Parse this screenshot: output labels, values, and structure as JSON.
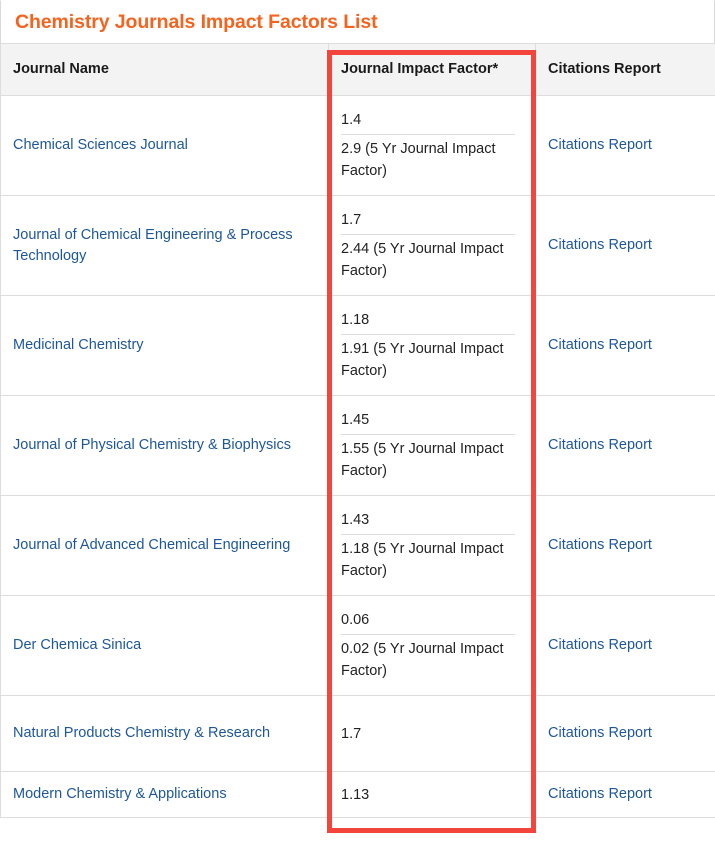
{
  "page_title": "Chemistry Journals Impact Factors List",
  "accent_color": "#f4641e",
  "link_color": "#1e5799",
  "annotation_color": "#f4453c",
  "table": {
    "headers": {
      "journal_name": "Journal Name",
      "impact_factor": "Journal Impact Factor*",
      "citations_report": "Citations Report"
    },
    "rows": [
      {
        "journal": "Chemical Sciences Journal",
        "impact_factor": "1.4",
        "impact_factor_5yr": "2.9 (5 Yr Journal Impact Factor)",
        "citations": "Citations Report"
      },
      {
        "journal": "Journal of Chemical Engineering & Process Technology",
        "impact_factor": "1.7",
        "impact_factor_5yr": "2.44 (5 Yr Journal Impact Factor)",
        "citations": "Citations Report"
      },
      {
        "journal": "Medicinal Chemistry",
        "impact_factor": "1.18",
        "impact_factor_5yr": "1.91 (5 Yr Journal Impact Factor)",
        "citations": "Citations Report"
      },
      {
        "journal": "Journal of Physical Chemistry & Biophysics",
        "impact_factor": "1.45",
        "impact_factor_5yr": "1.55 (5 Yr Journal Impact Factor)",
        "citations": "Citations Report"
      },
      {
        "journal": "Journal of Advanced Chemical Engineering",
        "impact_factor": "1.43",
        "impact_factor_5yr": "1.18 (5 Yr Journal Impact Factor)",
        "citations": "Citations Report"
      },
      {
        "journal": "Der Chemica Sinica",
        "impact_factor": "0.06",
        "impact_factor_5yr": "0.02 (5 Yr Journal Impact Factor)",
        "citations": "Citations Report"
      },
      {
        "journal": "Natural Products Chemistry & Research",
        "impact_factor": "1.7",
        "impact_factor_5yr": "",
        "citations": "Citations Report"
      },
      {
        "journal": "Modern Chemistry & Applications",
        "impact_factor": "1.13",
        "impact_factor_5yr": "",
        "citations": "Citations Report"
      }
    ]
  }
}
